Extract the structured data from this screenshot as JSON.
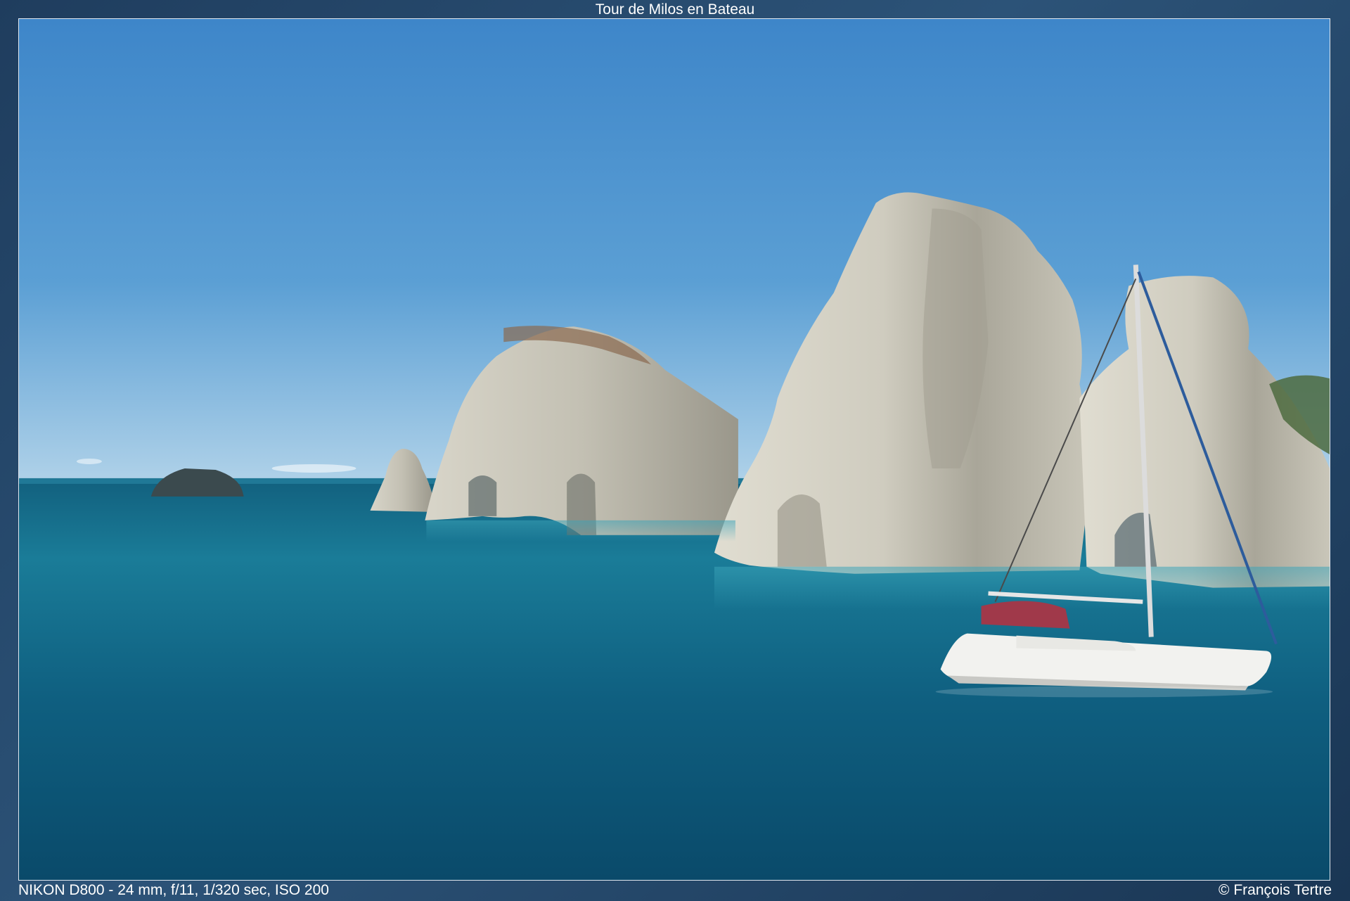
{
  "header": {
    "title": "Tour de Milos en Bateau"
  },
  "footer": {
    "exif": "NIKON D800 - 24 mm, f/11, 1/320 sec, ISO 200",
    "copyright": "© François Tertre"
  },
  "colors": {
    "frame_background": "#244668",
    "sky_top": "#2f7cc8",
    "sky_horizon": "#9cc7e4",
    "sea_deep": "#0b4f72",
    "sea_light": "#1f8aa8",
    "rock_light": "#d6d3c7",
    "rock_shadow": "#8b887d"
  }
}
